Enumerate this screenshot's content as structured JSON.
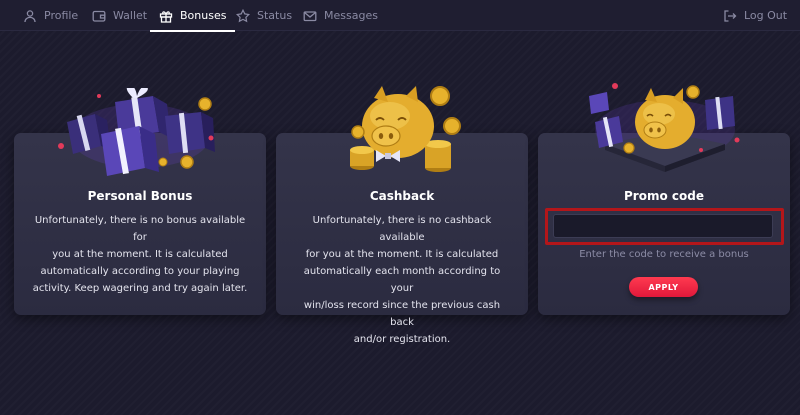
{
  "nav": {
    "tabs": [
      {
        "label": "Profile",
        "icon": "user-icon"
      },
      {
        "label": "Wallet",
        "icon": "wallet-icon"
      },
      {
        "label": "Bonuses",
        "icon": "gift-icon",
        "active": true
      },
      {
        "label": "Status",
        "icon": "star-icon"
      },
      {
        "label": "Messages",
        "icon": "envelope-icon"
      }
    ],
    "logout": {
      "label": "Log Out",
      "icon": "logout-icon"
    }
  },
  "cards": [
    {
      "title": "Personal Bonus",
      "lines": [
        "Unfortunately, there is no bonus available for",
        "you at the moment. It is calculated",
        "automatically according to your playing",
        "activity. Keep wagering and try again later."
      ],
      "image": "gift-boxes-illustration"
    },
    {
      "title": "Cashback",
      "lines": [
        "Unfortunately, there is no cashback available",
        "for you at the moment. It is calculated",
        "automatically each month according to your",
        "win/loss record since the previous cash back",
        "and/or registration."
      ],
      "image": "piggy-bank-coins-illustration"
    },
    {
      "title": "Promo code",
      "input": {
        "value": "",
        "placeholder": ""
      },
      "hint": "Enter the code to receive a bonus",
      "button": "APPLY",
      "image": "piggy-bank-gifts-illustration"
    }
  ],
  "colors": {
    "background": "#1c1b2d",
    "card": "#30304a",
    "accent": "#e8203f",
    "highlight_frame": "#b3161a",
    "gold": "#e7b22c"
  }
}
